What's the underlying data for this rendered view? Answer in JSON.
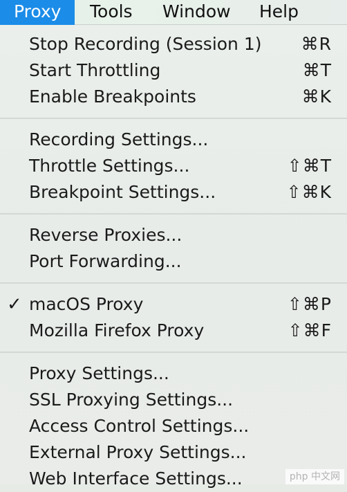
{
  "menubar": {
    "items": [
      {
        "label": "Proxy",
        "active": true
      },
      {
        "label": "Tools"
      },
      {
        "label": "Window"
      },
      {
        "label": "Help"
      }
    ]
  },
  "menu": {
    "groups": [
      [
        {
          "label": "Stop Recording (Session 1)",
          "shortcut": "⌘R"
        },
        {
          "label": "Start Throttling",
          "shortcut": "⌘T"
        },
        {
          "label": "Enable Breakpoints",
          "shortcut": "⌘K"
        }
      ],
      [
        {
          "label": "Recording Settings..."
        },
        {
          "label": "Throttle Settings...",
          "shortcut": "⇧⌘T"
        },
        {
          "label": "Breakpoint Settings...",
          "shortcut": "⇧⌘K"
        }
      ],
      [
        {
          "label": "Reverse Proxies..."
        },
        {
          "label": "Port Forwarding..."
        }
      ],
      [
        {
          "label": "macOS Proxy",
          "shortcut": "⇧⌘P",
          "checked": true,
          "check_glyph": "✓"
        },
        {
          "label": "Mozilla Firefox Proxy",
          "shortcut": "⇧⌘F"
        }
      ],
      [
        {
          "label": "Proxy Settings..."
        },
        {
          "label": "SSL Proxying Settings..."
        },
        {
          "label": "Access Control Settings..."
        },
        {
          "label": "External Proxy Settings..."
        },
        {
          "label": "Web Interface Settings..."
        }
      ]
    ]
  },
  "watermark": {
    "text": "php 中文网"
  },
  "colors": {
    "accent": "#1b8ce8",
    "menubar_bg": "#e6f1e8",
    "menu_bg": "#e9ede9"
  }
}
